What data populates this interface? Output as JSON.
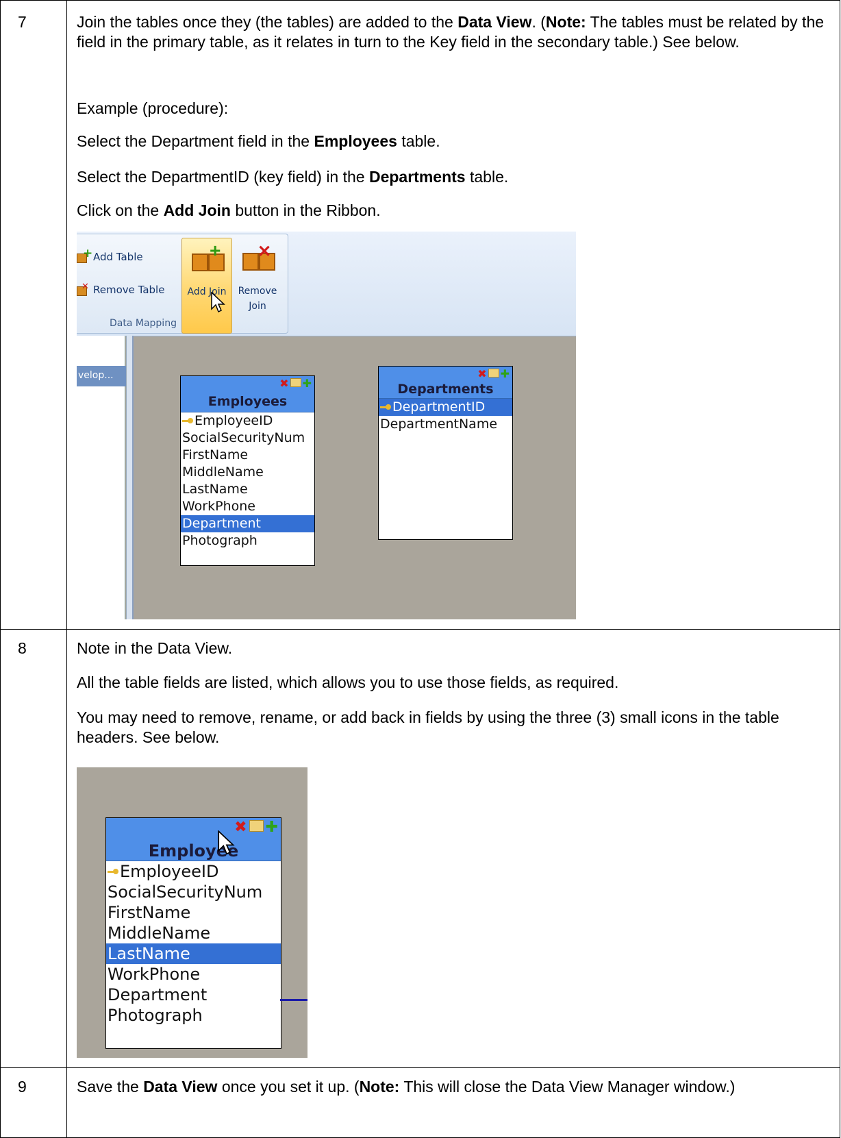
{
  "steps": [
    {
      "number": "7",
      "p1": {
        "t1": "Join the tables once they (the tables) are added to the ",
        "b1": "Data View",
        "t2": ". (",
        "b2": "Note:",
        "t3": "  The tables must be related by the field in the primary table, as it relates in turn to the Key field in the secondary table.) See below."
      },
      "p2": "Example (procedure):",
      "p3": {
        "t1": "Select the Department field in the ",
        "b1": "Employees",
        "t2": " table."
      },
      "p4": {
        "t1": "Select the DepartmentID (key field) in the ",
        "b1": "Departments",
        "t2": " table."
      },
      "p5": {
        "t1": "Click on the ",
        "b1": "Add Join",
        "t2": " button in the Ribbon."
      }
    },
    {
      "number": "8",
      "p1": "Note in the Data View.",
      "p2": "All the table fields are listed, which allows you to use those fields, as required.",
      "p3": "You may need to remove, rename, or add back in fields by using the three (3) small icons in the table headers. See below."
    },
    {
      "number": "9",
      "p1": {
        "t1": "Save the ",
        "b1": "Data View",
        "t2": " once you set it up. (",
        "b2": "Note:",
        "t3": "  This will close the Data View Manager window.)"
      }
    }
  ],
  "screenshot1": {
    "ribbon": {
      "add_table": "Add Table",
      "remove_table": "Remove Table",
      "add_join": "Add Join",
      "remove_join_1": "Remove",
      "remove_join_2": "Join",
      "group_caption": "Data Mapping"
    },
    "left_tab": "velop...",
    "employees": {
      "title": "Employees",
      "fields": [
        "EmployeeID",
        "SocialSecurityNum",
        "FirstName",
        "MiddleName",
        "LastName",
        "WorkPhone",
        "Department",
        "Photograph"
      ],
      "selected": "Department"
    },
    "departments": {
      "title": "Departments",
      "fields": [
        "DepartmentID",
        "DepartmentName"
      ],
      "selected": "DepartmentID"
    }
  },
  "screenshot2": {
    "employees": {
      "title": "Employee",
      "fields": [
        "EmployeeID",
        "SocialSecurityNum",
        "FirstName",
        "MiddleName",
        "LastName",
        "WorkPhone",
        "Department",
        "Photograph"
      ],
      "selected": "LastName"
    }
  },
  "colors": {
    "header_blue": "#4f8fe8",
    "selection_blue": "#3470d4",
    "canvas_gray": "#aaa59b",
    "ribbon_highlight": "#ffd873"
  }
}
